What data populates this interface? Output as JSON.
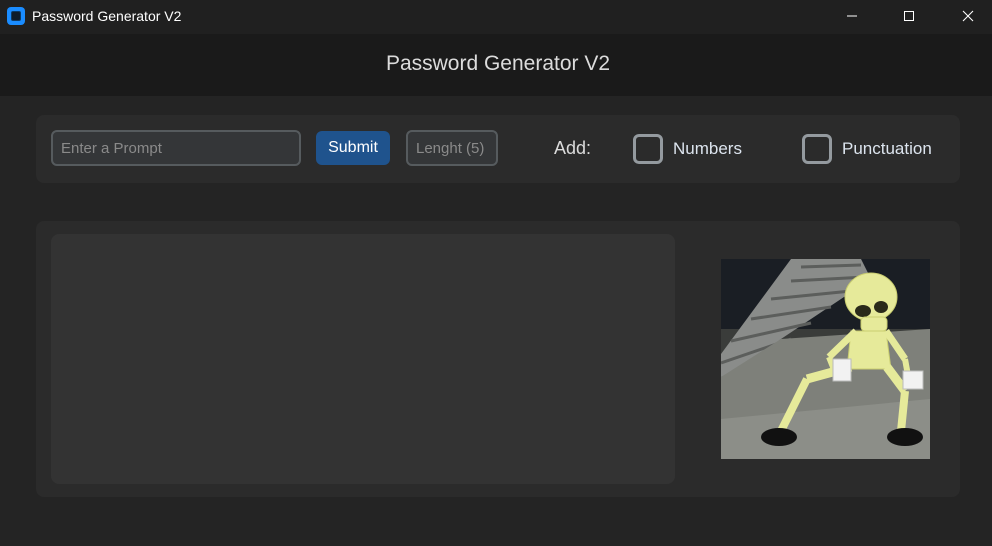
{
  "window": {
    "title": "Password Generator V2",
    "controls": {
      "minimize_icon": "minimize-icon",
      "maximize_icon": "maximize-icon",
      "close_icon": "close-icon"
    }
  },
  "header": {
    "title": "Password Generator V2"
  },
  "controls": {
    "prompt_placeholder": "Enter a Prompt",
    "prompt_value": "",
    "submit_label": "Submit",
    "length_placeholder": "Lenght (5)",
    "length_value": "",
    "add_label": "Add:",
    "checkboxes": [
      {
        "label": "Numbers",
        "checked": false
      },
      {
        "label": "Punctuation",
        "checked": false
      }
    ]
  },
  "output": {
    "text": ""
  },
  "image": {
    "subject": "dancing-skeleton-gif"
  },
  "colors": {
    "accent": "#1f538d",
    "app_icon": "#1a8cff",
    "background": "#242424",
    "panel": "#2b2b2b",
    "textbox": "#333333"
  }
}
